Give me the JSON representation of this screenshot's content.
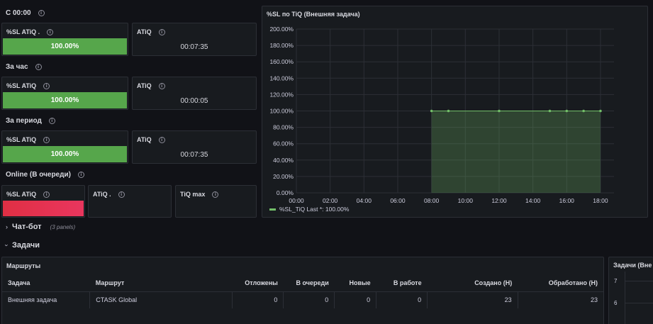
{
  "sections": [
    {
      "label": "С 00:00",
      "sl": {
        "title": "%SL ATiQ .",
        "value": "100.00%"
      },
      "atiq": {
        "title": "ATiQ",
        "value": "00:07:35"
      }
    },
    {
      "label": "За час",
      "sl": {
        "title": "%SL ATiQ",
        "value": "100.00%"
      },
      "atiq": {
        "title": "ATiQ",
        "value": "00:00:05"
      }
    },
    {
      "label": "За период",
      "sl": {
        "title": "%SL ATiQ",
        "value": "100.00%"
      },
      "atiq": {
        "title": "ATiQ",
        "value": "00:07:35"
      }
    }
  ],
  "online": {
    "label": "Online (В очереди)",
    "sl_title": "%SL ATiQ",
    "atiq_title": "ATiQ .",
    "tiqmax_title": "TiQ max"
  },
  "colors": {
    "green": "#56a64b",
    "red": "#e02f44",
    "bg": "#111217",
    "panel": "#181b1f"
  },
  "chart_panel": {
    "title": "%SL по TiQ (Внешняя задача)"
  },
  "chart_data": {
    "type": "area",
    "title": "%SL по TiQ (Внешняя задача)",
    "x_ticks": [
      "00:00",
      "02:00",
      "04:00",
      "06:00",
      "08:00",
      "10:00",
      "12:00",
      "14:00",
      "16:00",
      "18:00"
    ],
    "y_ticks": [
      "0.00%",
      "20.00%",
      "40.00%",
      "60.00%",
      "80.00%",
      "100.00%",
      "120.00%",
      "140.00%",
      "160.00%",
      "180.00%",
      "200.00%"
    ],
    "ylim": [
      0,
      200
    ],
    "xlim_hours": [
      0,
      18.8
    ],
    "grid": true,
    "legend_placement": "bottom-left",
    "series": [
      {
        "name": "%SL_TiQ",
        "color": "#73bf69",
        "x": [
          "08:00",
          "09:00",
          "12:00",
          "15:00",
          "16:00",
          "17:00",
          "18:00"
        ],
        "x_hours": [
          8,
          9,
          12,
          15,
          16,
          17,
          18
        ],
        "y": [
          100,
          100,
          100,
          100,
          100,
          100,
          100
        ]
      }
    ],
    "legend_text": "%SL_TiQ  Last *: 100.00%"
  },
  "rows": {
    "chatbot": {
      "chevron": "›",
      "title": "Чат-бот",
      "meta": "(3 panels)"
    },
    "tasks": {
      "chevron": "›",
      "title": "Задачи"
    }
  },
  "routes": {
    "title": "Маршруты",
    "headers": [
      "Задача",
      "Маршрут",
      "Отложены",
      "В очереди",
      "Новые",
      "В работе",
      "Создано (Н)",
      "Обработано (Н)"
    ],
    "rows": [
      [
        "Внешняя задача",
        "CTASK Global",
        "0",
        "0",
        "0",
        "0",
        "23",
        "23"
      ]
    ]
  },
  "side_panel": {
    "title": "Задачи (Вне",
    "ticks": [
      "7",
      "6"
    ]
  },
  "icons": {
    "info": "info-icon",
    "chevron": "chevron-icon"
  }
}
